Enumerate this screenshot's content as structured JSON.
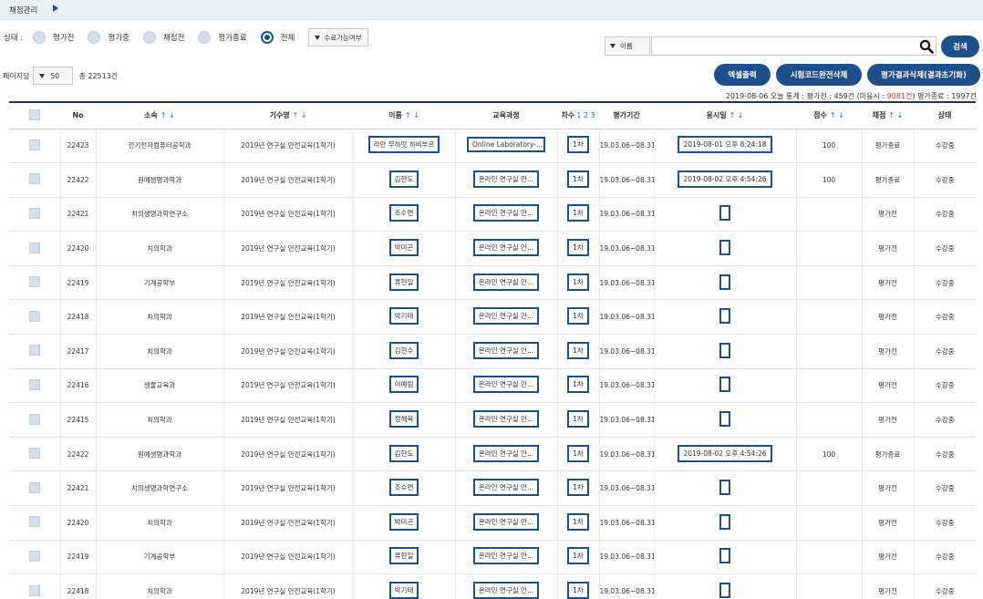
{
  "header": {
    "title": "채점관리"
  },
  "filter": {
    "label": "상태 :",
    "options": [
      {
        "label": "평가전",
        "checked": false
      },
      {
        "label": "평가중",
        "checked": false
      },
      {
        "label": "채점전",
        "checked": false
      },
      {
        "label": "평가종료",
        "checked": false
      },
      {
        "label": "전체",
        "checked": true
      }
    ],
    "completion_select": "수료가능여부"
  },
  "search": {
    "field": "이름",
    "value": "",
    "button": "검색"
  },
  "actions": {
    "excel": "엑셀출력",
    "delete_code": "시험코드완전삭제",
    "delete_result": "평가결과삭제(결과초기화)"
  },
  "paging": {
    "label": "페이지당",
    "per_page": "50",
    "total": "총 22513건"
  },
  "stats": {
    "prefix": "2019-08-06 오늘 통계 : 평가전 : 459건 (미응시 : ",
    "unattempted": "9081건",
    "suffix": ")  평가종료 : 1997건"
  },
  "columns": [
    "No",
    "소속",
    "기수명",
    "이름",
    "교육과정",
    "차수",
    "평가기간",
    "응시일",
    "점수",
    "채점",
    "상태"
  ],
  "cycles": "1 2 3",
  "sort_arrows": "↑ ↓",
  "rows": [
    {
      "no": "22423",
      "dept": "전기전자컴퓨터공학과",
      "term": "2019년 연구실 안전교육(1학기)",
      "name": "라만 무하맛 하비부르",
      "course": "Online Laboratory-...",
      "round": "1차",
      "period": "19.03.06~08.31",
      "date": "2019-08-01 오후 8:24:18",
      "score": "100",
      "grade": "평가종료",
      "status": "수강중"
    },
    {
      "no": "22422",
      "dept": "원예생명과학과",
      "term": "2019년 연구실 안전교육(1학기)",
      "name": "김현도",
      "course": "온라인 연구실 안...",
      "round": "1차",
      "period": "19.03.06~08.31",
      "date": "2019-08-02 오후 4:54:26",
      "score": "100",
      "grade": "평가종료",
      "status": "수강중"
    },
    {
      "no": "22421",
      "dept": "치의생명과학연구소",
      "term": "2019년 연구실 안전교육(1학기)",
      "name": "조수연",
      "course": "온라인 연구실 안...",
      "round": "1차",
      "period": "19.03.06~08.31",
      "date": "",
      "score": "",
      "grade": "평가전",
      "status": "수강중"
    },
    {
      "no": "22420",
      "dept": "치의학과",
      "term": "2019년 연구실 안전교육(1학기)",
      "name": "박미곤",
      "course": "온라인 연구실 안...",
      "round": "1차",
      "period": "19.03.06~08.31",
      "date": "",
      "score": "",
      "grade": "평가전",
      "status": "수강중"
    },
    {
      "no": "22419",
      "dept": "기계공학부",
      "term": "2019년 연구실 안전교육(1학기)",
      "name": "류현일",
      "course": "온라인 연구실 안...",
      "round": "1차",
      "period": "19.03.06~08.31",
      "date": "",
      "score": "",
      "grade": "평가전",
      "status": "수강중"
    },
    {
      "no": "22418",
      "dept": "치의학과",
      "term": "2019년 연구실 안전교육(1학기)",
      "name": "박기태",
      "course": "온라인 연구실 안...",
      "round": "1차",
      "period": "19.03.06~08.31",
      "date": "",
      "score": "",
      "grade": "평가전",
      "status": "수강중"
    },
    {
      "no": "22417",
      "dept": "치의학과",
      "term": "2019년 연구실 안전교육(1학기)",
      "name": "김현수",
      "course": "온라인 연구실 안...",
      "round": "1차",
      "period": "19.03.06~08.31",
      "date": "",
      "score": "",
      "grade": "평가전",
      "status": "수강중"
    },
    {
      "no": "22416",
      "dept": "생물교육과",
      "term": "2019년 연구실 안전교육(1학기)",
      "name": "이예림",
      "course": "온라인 연구실 안...",
      "round": "1차",
      "period": "19.03.06~08.31",
      "date": "",
      "score": "",
      "grade": "평가전",
      "status": "수강중"
    },
    {
      "no": "22415",
      "dept": "치의학과",
      "term": "2019년 연구실 안전교육(1학기)",
      "name": "정혜육",
      "course": "온라인 연구실 안...",
      "round": "1차",
      "period": "19.03.06~08.31",
      "date": "",
      "score": "",
      "grade": "평가전",
      "status": "수강중"
    },
    {
      "no": "22422",
      "dept": "원예생명과학과",
      "term": "2019년 연구실 안전교육(1학기)",
      "name": "김현도",
      "course": "온라인 연구실 안...",
      "round": "1차",
      "period": "19.03.06~08.31",
      "date": "2019-08-02 오후 4:54:26",
      "score": "100",
      "grade": "평가종료",
      "status": "수강중"
    },
    {
      "no": "22421",
      "dept": "치의생명과학연구소",
      "term": "2019년 연구실 안전교육(1학기)",
      "name": "조수연",
      "course": "온라인 연구실 안...",
      "round": "1차",
      "period": "19.03.06~08.31",
      "date": "",
      "score": "",
      "grade": "평가전",
      "status": "수강중"
    },
    {
      "no": "22420",
      "dept": "치의학과",
      "term": "2019년 연구실 안전교육(1학기)",
      "name": "박미곤",
      "course": "온라인 연구실 안...",
      "round": "1차",
      "period": "19.03.06~08.31",
      "date": "",
      "score": "",
      "grade": "평가전",
      "status": "수강중"
    },
    {
      "no": "22419",
      "dept": "기계공학부",
      "term": "2019년 연구실 안전교육(1학기)",
      "name": "류현일",
      "course": "온라인 연구실 안...",
      "round": "1차",
      "period": "19.03.06~08.31",
      "date": "",
      "score": "",
      "grade": "평가전",
      "status": "수강중"
    },
    {
      "no": "22418",
      "dept": "치의학과",
      "term": "2019년 연구실 안전교육(1학기)",
      "name": "박기태",
      "course": "온라인 연구실 안...",
      "round": "1차",
      "period": "19.03.06~08.31",
      "date": "",
      "score": "",
      "grade": "평가전",
      "status": "수강중"
    }
  ]
}
